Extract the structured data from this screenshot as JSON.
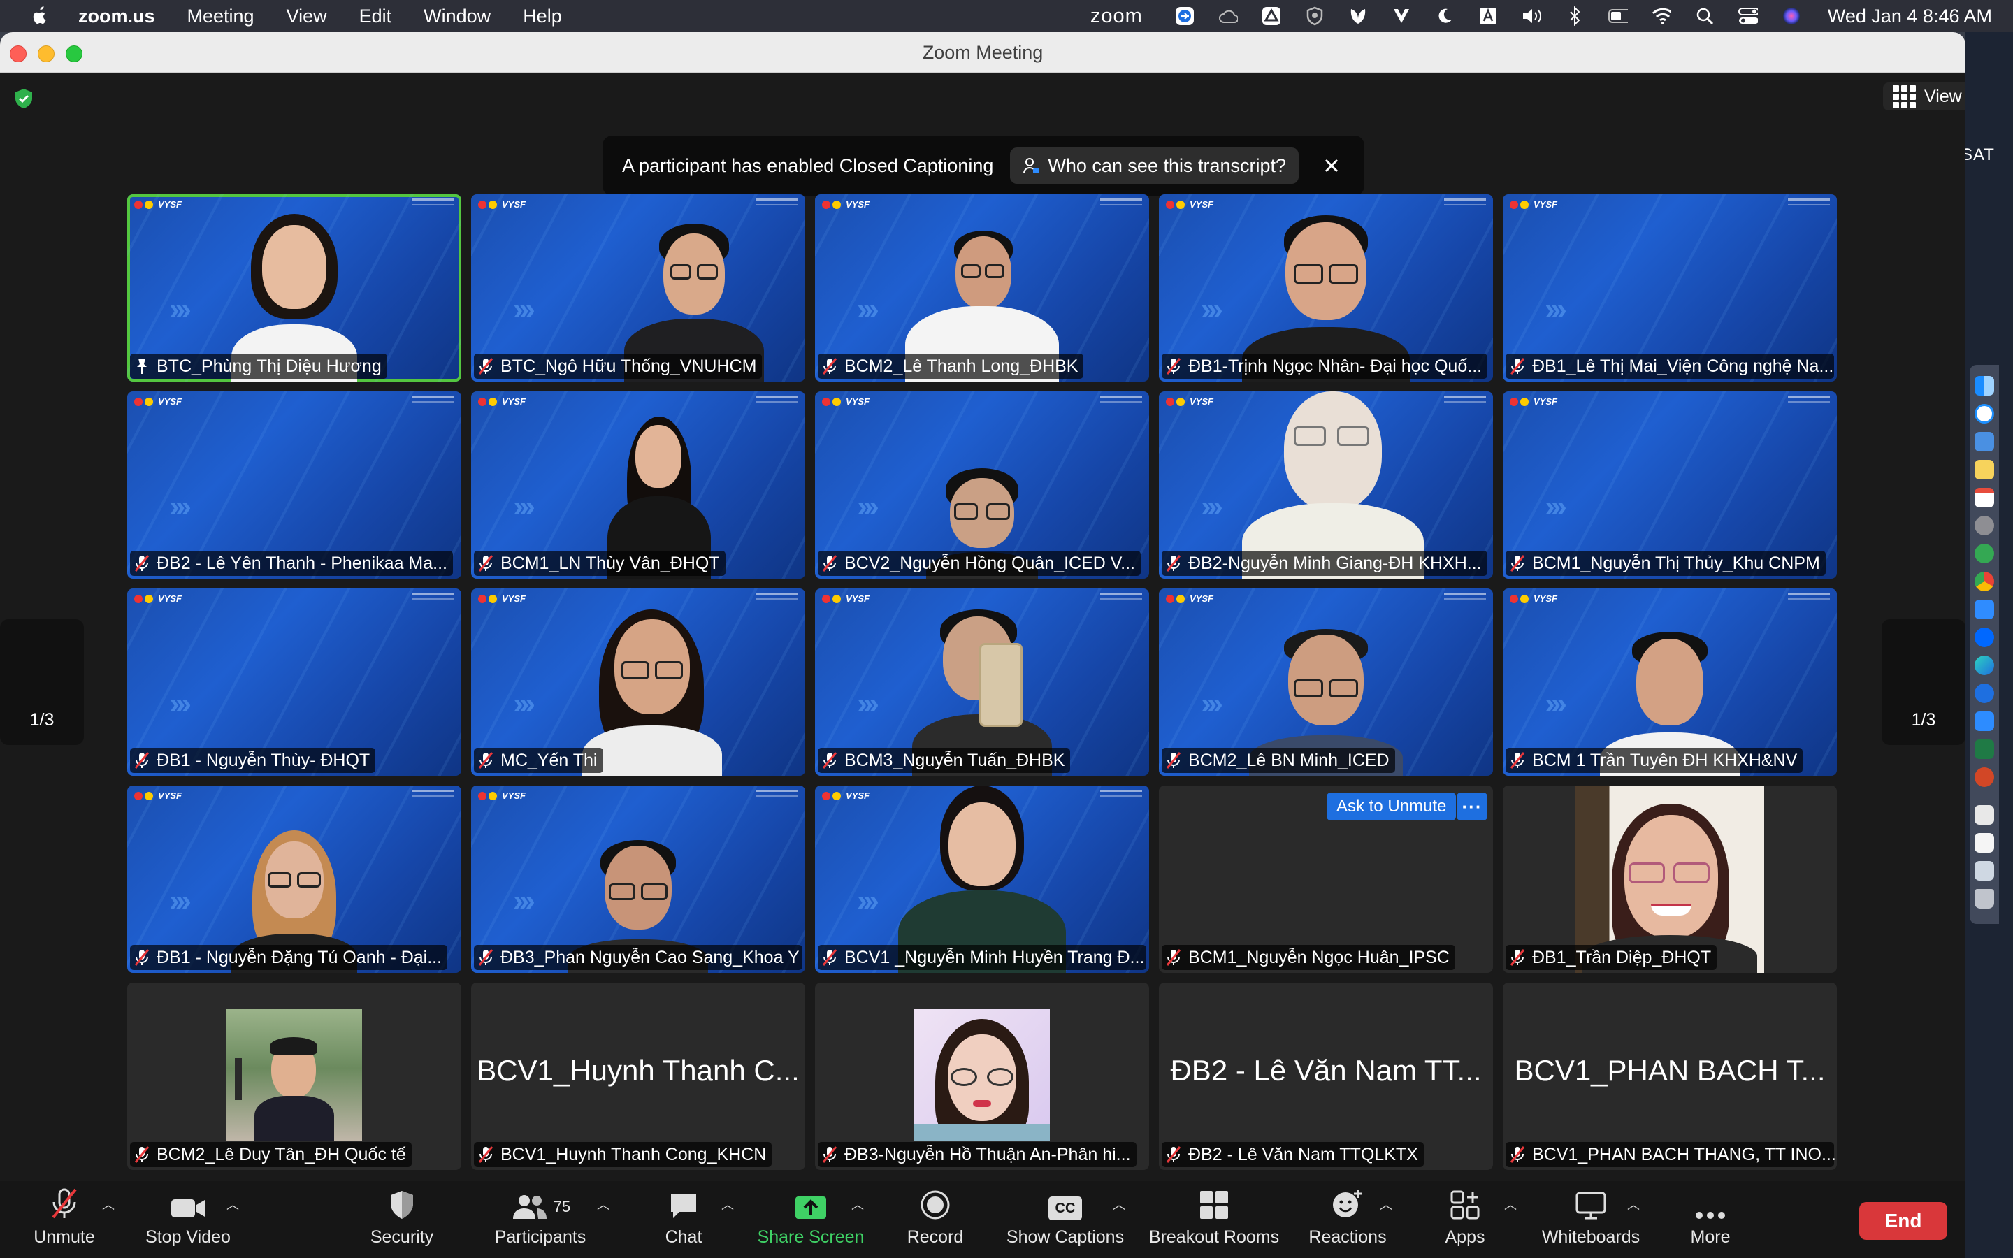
{
  "menubar": {
    "app_name": "zoom.us",
    "menus": [
      "Meeting",
      "View",
      "Edit",
      "Window",
      "Help"
    ],
    "zoom_word": "zoom",
    "clock": "Wed Jan 4  8:46 AM"
  },
  "window": {
    "title": "Zoom Meeting",
    "view_label": "View"
  },
  "banner": {
    "message": "A participant has enabled Closed Captioning",
    "who_label": "Who can see this transcript?"
  },
  "desktop": {
    "side_text": "SAT"
  },
  "pager": {
    "left_page": "1/3",
    "right_page": "1/3"
  },
  "tiles": [
    {
      "name": "BTC_Phùng Thị Diệu Hương"
    },
    {
      "name": "BTC_Ngô Hữu Thống_VNUHCM"
    },
    {
      "name": "BCM2_Lê Thanh Long_ĐHBK"
    },
    {
      "name": "ĐB1-Trịnh Ngọc Nhân- Đại học Quố..."
    },
    {
      "name": "ĐB1_Lê Thị Mai_Viện Công nghệ Na..."
    },
    {
      "name": "ĐB2 - Lê Yên Thanh - Phenikaa Ma..."
    },
    {
      "name": "BCM1_LN Thùy Vân_ĐHQT"
    },
    {
      "name": "BCV2_Nguyễn Hồng Quân_ICED V..."
    },
    {
      "name": "ĐB2-Nguyễn Minh Giang-ĐH KHXH..."
    },
    {
      "name": "BCM1_Nguyễn Thị Thủy_Khu CNPM"
    },
    {
      "name": "ĐB1 - Nguyễn Thùy- ĐHQT"
    },
    {
      "name": "MC_Yến Thi"
    },
    {
      "name": "BCM3_Nguyễn Tuấn_ĐHBK"
    },
    {
      "name": "BCM2_Lê BN Minh_ICED"
    },
    {
      "name": "BCM 1 Trần Tuyên ĐH KHXH&NV"
    },
    {
      "name": "ĐB1 - Nguyễn Đặng Tú Oanh - Đại..."
    },
    {
      "name": "ĐB3_Phan Nguyễn Cao Sang_Khoa Y"
    },
    {
      "name": "BCV1 _Nguyễn Minh Huyền Trang Đ..."
    },
    {
      "name": "BCM1_Nguyễn Ngọc Huân_IPSC",
      "ask_label": "Ask to Unmute",
      "more_label": "···"
    },
    {
      "name": "ĐB1_Trần Diệp_ĐHQT"
    },
    {
      "name": "BCM2_Lê Duy Tân_ĐH Quốc tế"
    },
    {
      "name": "BCV1_Huynh Thanh Cong_KHCN",
      "big": "BCV1_Huynh Thanh C..."
    },
    {
      "name": "ĐB3-Nguyễn Hồ Thuận An-Phân hi..."
    },
    {
      "name": "ĐB2 - Lê Văn Nam TTQLKTX",
      "big": "ĐB2 - Lê Văn Nam TT..."
    },
    {
      "name": "BCV1_PHAN BACH THANG, TT INO...",
      "big": "BCV1_PHAN BACH T..."
    }
  ],
  "toolbar": {
    "unmute": "Unmute",
    "stop_video": "Stop Video",
    "security": "Security",
    "participants": "Participants",
    "participants_count": "75",
    "chat": "Chat",
    "share_screen": "Share Screen",
    "record": "Record",
    "show_captions": "Show Captions",
    "cc_text": "CC",
    "breakout_rooms": "Breakout Rooms",
    "reactions": "Reactions",
    "apps": "Apps",
    "whiteboards": "Whiteboards",
    "more": "More",
    "end": "End"
  },
  "colors": {
    "active_speaker": "#54c640",
    "share_green": "#3fd165",
    "end_red": "#d9373a",
    "ask_blue": "#1e6fe0",
    "bg_blue": "#1b4fb0"
  }
}
